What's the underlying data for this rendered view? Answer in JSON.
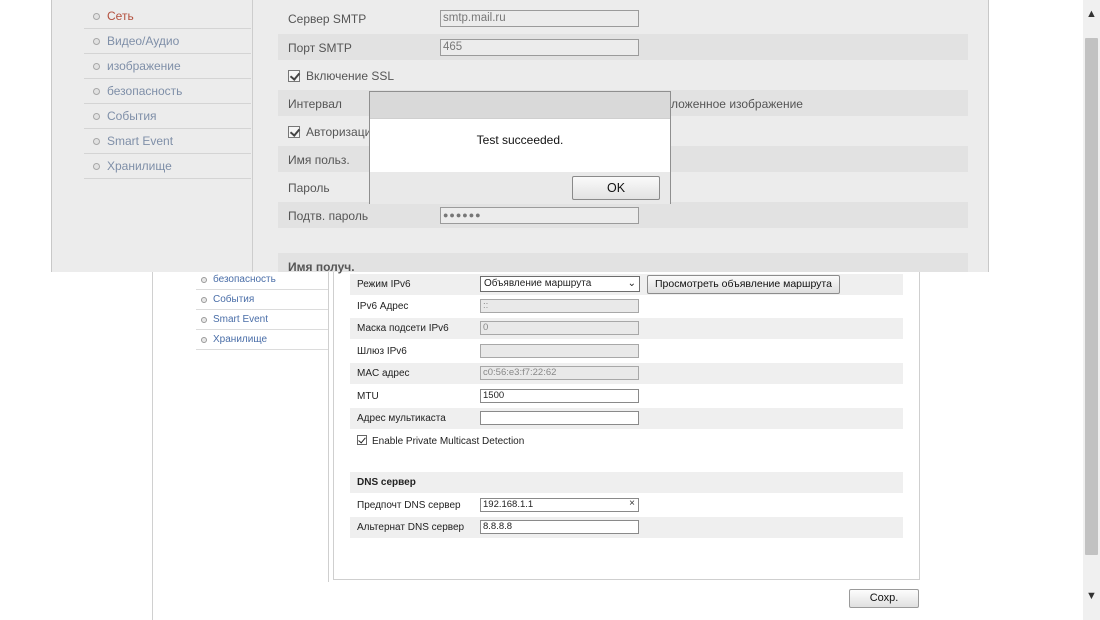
{
  "bottom_page": {
    "sidebar": [
      "безопасность",
      "События",
      "Smart Event",
      "Хранилище"
    ],
    "ipv6_mode": {
      "label": "Режим IPv6",
      "value": "Объявление маршрута",
      "button": "Просмотреть объявление маршрута"
    },
    "fields": [
      {
        "label": "IPv6 Адрес",
        "value": "::"
      },
      {
        "label": "Маска подсети IPv6",
        "value": "0"
      },
      {
        "label": "Шлюз IPv6",
        "value": ""
      },
      {
        "label": "MAC адрес",
        "value": "c0:56:e3:f7:22:62"
      },
      {
        "label": "MTU",
        "value": "1500"
      },
      {
        "label": "Адрес мультикаста",
        "value": ""
      }
    ],
    "multicast_detection": "Enable Private Multicast Detection",
    "dns_header": "DNS сервер",
    "dns_preferred": {
      "label": "Предпочт DNS сервер",
      "value": "192.168.1.1",
      "clear": "×"
    },
    "dns_alternate": {
      "label": "Альтернат DNS сервер",
      "value": "8.8.8.8"
    },
    "save": "Сохр."
  },
  "top_page": {
    "sidebar": [
      "Сеть",
      "Видео/Аудио",
      "изображение",
      "безопасность",
      "События",
      "Smart Event",
      "Хранилище"
    ],
    "smtp_server": {
      "label": "Сервер SMTP",
      "value": "smtp.mail.ru"
    },
    "smtp_port": {
      "label": "Порт SMTP",
      "value": "465"
    },
    "ssl": "Включение SSL",
    "interval": {
      "label": "Интервал",
      "tail": "ложенное изображение"
    },
    "auth": "Авторизаци",
    "username": "Имя польз.",
    "password": "Пароль",
    "password_confirm": {
      "label": "Подтв. пароль",
      "value": "●●●●●●"
    },
    "recipient": "Имя получ."
  },
  "modal": {
    "message": "Test succeeded.",
    "ok": "OK"
  },
  "scrollbar": {
    "up": "▲",
    "down": "▼"
  }
}
